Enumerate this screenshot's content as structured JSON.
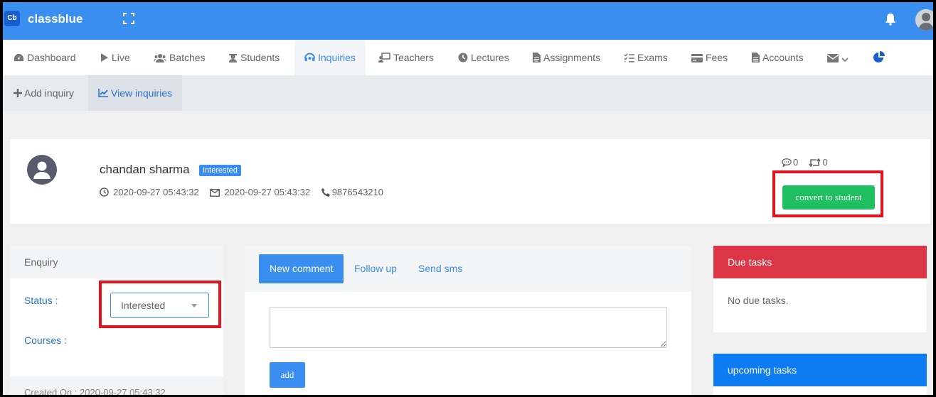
{
  "app": {
    "logo_text": "Cb",
    "brand": "classblue"
  },
  "nav": {
    "items": [
      {
        "label": "Dashboard",
        "icon": "dashboard-icon"
      },
      {
        "label": "Live",
        "icon": "play-icon"
      },
      {
        "label": "Batches",
        "icon": "users-icon"
      },
      {
        "label": "Students",
        "icon": "student-icon"
      },
      {
        "label": "Inquiries",
        "icon": "headset-icon",
        "active": true
      },
      {
        "label": "Teachers",
        "icon": "teacher-icon"
      },
      {
        "label": "Lectures",
        "icon": "clock-icon"
      },
      {
        "label": "Assignments",
        "icon": "file-icon"
      },
      {
        "label": "Exams",
        "icon": "list-check-icon"
      },
      {
        "label": "Fees",
        "icon": "credit-card-icon"
      },
      {
        "label": "Accounts",
        "icon": "file-alt-icon"
      }
    ],
    "mail_icon": "envelope-icon",
    "chart_icon": "pie-chart-icon"
  },
  "subnav": {
    "add_label": "Add inquiry",
    "view_label": "View inquiries"
  },
  "profile": {
    "name": "chandan sharma",
    "status": "Interested",
    "created": "2020-09-27 05:43:32",
    "updated": "2020-09-27 05:43:32",
    "phone": "9876543210",
    "comment_count": "0",
    "retweet_count": "0",
    "convert_label": "convert to student"
  },
  "enquiry": {
    "title": "Enquiry",
    "status_label": "Status :",
    "status_value": "Interested",
    "courses_label": "Courses :",
    "created_on": "Created On : 2020-09-27 05:43:32"
  },
  "comments": {
    "tabs": [
      "New comment",
      "Follow up",
      "Send sms"
    ],
    "add_label": "add"
  },
  "tasks": {
    "due_title": "Due tasks",
    "due_empty": "No due tasks.",
    "upcoming_title": "upcoming tasks"
  },
  "colors": {
    "primary": "#3a8ef0",
    "success": "#1fbf62",
    "danger": "#dc3545",
    "highlight": "#e3141b"
  }
}
